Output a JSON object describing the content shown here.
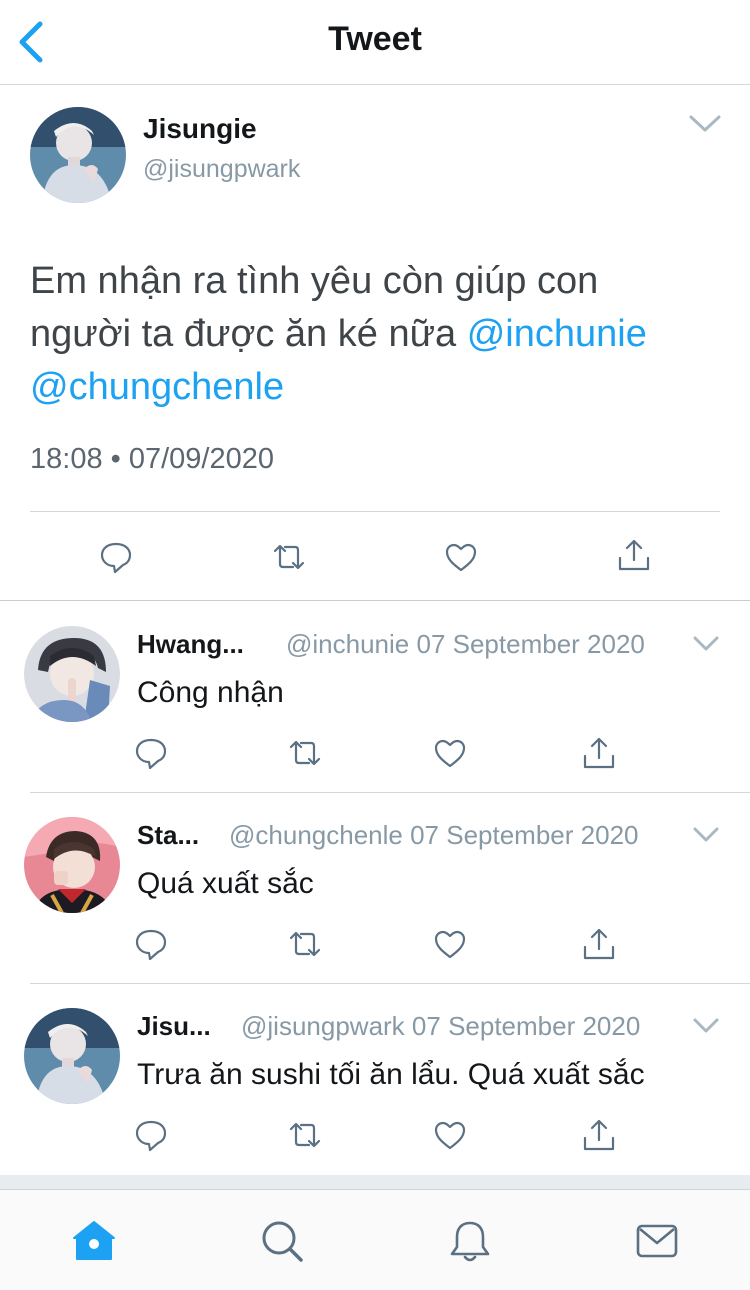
{
  "header": {
    "title": "Tweet"
  },
  "main_tweet": {
    "name": "Jisungie",
    "handle": "@jisungpwark",
    "text_line1": "Em nhận ra tình yêu còn giúp con",
    "text_line2_plain": "người ta được ăn ké nữa ",
    "mention1": "@inchunie",
    "mention2": "@chungchenle",
    "timestamp": "18:08 • 07/09/2020"
  },
  "replies": [
    {
      "name": "Hwang...",
      "handle": "@inchunie",
      "date": "07 September 2020",
      "text": "Công nhận"
    },
    {
      "name": "Sta...",
      "handle": "@chungchenle",
      "date": "07 September 2020",
      "text": "Quá xuất sắc"
    },
    {
      "name": "Jisu...",
      "handle": "@jisungpwark",
      "date": "07 September 2020",
      "text": "Trưa ăn sushi tối ăn lẩu. Quá xuất sắc"
    }
  ],
  "icons": {
    "back": "chevron-left-icon",
    "caret": "chevron-down-icon",
    "actions": [
      "reply-icon",
      "retweet-icon",
      "like-icon",
      "share-icon"
    ],
    "tabs": [
      "home-icon",
      "search-icon",
      "notifications-icon",
      "messages-icon"
    ]
  },
  "colors": {
    "accent": "#1da1f2",
    "secondary_text": "#8899a6",
    "action_icon": "#5b7083"
  }
}
